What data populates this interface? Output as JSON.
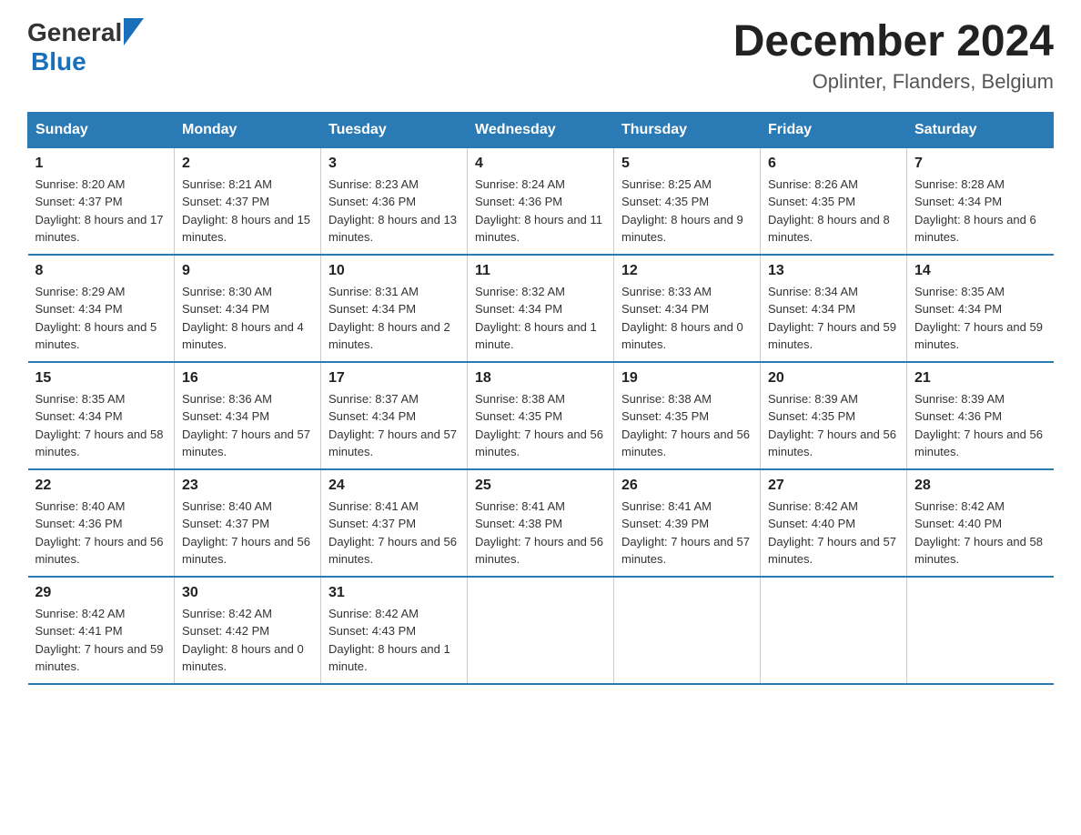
{
  "logo": {
    "general": "General",
    "blue": "Blue"
  },
  "title": "December 2024",
  "location": "Oplinter, Flanders, Belgium",
  "headers": [
    "Sunday",
    "Monday",
    "Tuesday",
    "Wednesday",
    "Thursday",
    "Friday",
    "Saturday"
  ],
  "weeks": [
    [
      {
        "day": "1",
        "sunrise": "8:20 AM",
        "sunset": "4:37 PM",
        "daylight": "8 hours and 17 minutes."
      },
      {
        "day": "2",
        "sunrise": "8:21 AM",
        "sunset": "4:37 PM",
        "daylight": "8 hours and 15 minutes."
      },
      {
        "day": "3",
        "sunrise": "8:23 AM",
        "sunset": "4:36 PM",
        "daylight": "8 hours and 13 minutes."
      },
      {
        "day": "4",
        "sunrise": "8:24 AM",
        "sunset": "4:36 PM",
        "daylight": "8 hours and 11 minutes."
      },
      {
        "day": "5",
        "sunrise": "8:25 AM",
        "sunset": "4:35 PM",
        "daylight": "8 hours and 9 minutes."
      },
      {
        "day": "6",
        "sunrise": "8:26 AM",
        "sunset": "4:35 PM",
        "daylight": "8 hours and 8 minutes."
      },
      {
        "day": "7",
        "sunrise": "8:28 AM",
        "sunset": "4:34 PM",
        "daylight": "8 hours and 6 minutes."
      }
    ],
    [
      {
        "day": "8",
        "sunrise": "8:29 AM",
        "sunset": "4:34 PM",
        "daylight": "8 hours and 5 minutes."
      },
      {
        "day": "9",
        "sunrise": "8:30 AM",
        "sunset": "4:34 PM",
        "daylight": "8 hours and 4 minutes."
      },
      {
        "day": "10",
        "sunrise": "8:31 AM",
        "sunset": "4:34 PM",
        "daylight": "8 hours and 2 minutes."
      },
      {
        "day": "11",
        "sunrise": "8:32 AM",
        "sunset": "4:34 PM",
        "daylight": "8 hours and 1 minute."
      },
      {
        "day": "12",
        "sunrise": "8:33 AM",
        "sunset": "4:34 PM",
        "daylight": "8 hours and 0 minutes."
      },
      {
        "day": "13",
        "sunrise": "8:34 AM",
        "sunset": "4:34 PM",
        "daylight": "7 hours and 59 minutes."
      },
      {
        "day": "14",
        "sunrise": "8:35 AM",
        "sunset": "4:34 PM",
        "daylight": "7 hours and 59 minutes."
      }
    ],
    [
      {
        "day": "15",
        "sunrise": "8:35 AM",
        "sunset": "4:34 PM",
        "daylight": "7 hours and 58 minutes."
      },
      {
        "day": "16",
        "sunrise": "8:36 AM",
        "sunset": "4:34 PM",
        "daylight": "7 hours and 57 minutes."
      },
      {
        "day": "17",
        "sunrise": "8:37 AM",
        "sunset": "4:34 PM",
        "daylight": "7 hours and 57 minutes."
      },
      {
        "day": "18",
        "sunrise": "8:38 AM",
        "sunset": "4:35 PM",
        "daylight": "7 hours and 56 minutes."
      },
      {
        "day": "19",
        "sunrise": "8:38 AM",
        "sunset": "4:35 PM",
        "daylight": "7 hours and 56 minutes."
      },
      {
        "day": "20",
        "sunrise": "8:39 AM",
        "sunset": "4:35 PM",
        "daylight": "7 hours and 56 minutes."
      },
      {
        "day": "21",
        "sunrise": "8:39 AM",
        "sunset": "4:36 PM",
        "daylight": "7 hours and 56 minutes."
      }
    ],
    [
      {
        "day": "22",
        "sunrise": "8:40 AM",
        "sunset": "4:36 PM",
        "daylight": "7 hours and 56 minutes."
      },
      {
        "day": "23",
        "sunrise": "8:40 AM",
        "sunset": "4:37 PM",
        "daylight": "7 hours and 56 minutes."
      },
      {
        "day": "24",
        "sunrise": "8:41 AM",
        "sunset": "4:37 PM",
        "daylight": "7 hours and 56 minutes."
      },
      {
        "day": "25",
        "sunrise": "8:41 AM",
        "sunset": "4:38 PM",
        "daylight": "7 hours and 56 minutes."
      },
      {
        "day": "26",
        "sunrise": "8:41 AM",
        "sunset": "4:39 PM",
        "daylight": "7 hours and 57 minutes."
      },
      {
        "day": "27",
        "sunrise": "8:42 AM",
        "sunset": "4:40 PM",
        "daylight": "7 hours and 57 minutes."
      },
      {
        "day": "28",
        "sunrise": "8:42 AM",
        "sunset": "4:40 PM",
        "daylight": "7 hours and 58 minutes."
      }
    ],
    [
      {
        "day": "29",
        "sunrise": "8:42 AM",
        "sunset": "4:41 PM",
        "daylight": "7 hours and 59 minutes."
      },
      {
        "day": "30",
        "sunrise": "8:42 AM",
        "sunset": "4:42 PM",
        "daylight": "8 hours and 0 minutes."
      },
      {
        "day": "31",
        "sunrise": "8:42 AM",
        "sunset": "4:43 PM",
        "daylight": "8 hours and 1 minute."
      },
      null,
      null,
      null,
      null
    ]
  ]
}
